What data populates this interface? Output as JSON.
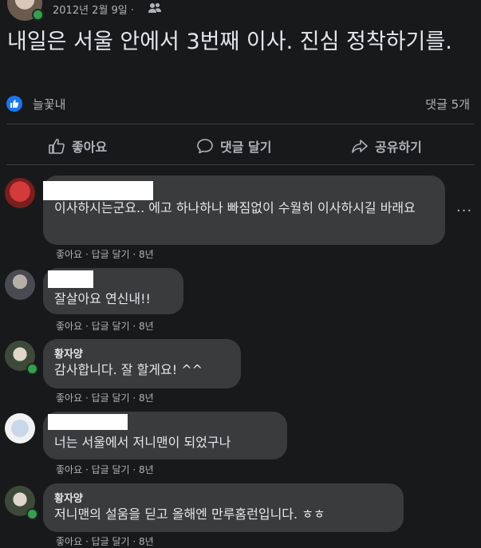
{
  "post": {
    "date": "2012년 2월 9일 ·",
    "privacy_icon": "friends-icon",
    "text": "내일은 서울 안에서 3번째 이사. 진심 정착하기를.",
    "liker": "늘꽃내",
    "comment_count": "댓글 5개"
  },
  "actions": {
    "like": "좋아요",
    "comment": "댓글 달기",
    "share": "공유하기"
  },
  "comments": [
    {
      "name": "",
      "text": "이사하시는군요.. 에고 하나하나 빠짐없이 수월히 이사하시길 바래요",
      "like": "좋아요",
      "reply": "답글 달기",
      "age": "8년"
    },
    {
      "name": "",
      "text": "잘살아요 연신내!!",
      "like": "좋아요",
      "reply": "답글 달기",
      "age": "8년"
    },
    {
      "name": "황자양",
      "text": "감사합니다. 잘 할게요! ^^",
      "like": "좋아요",
      "reply": "답글 달기",
      "age": "8년"
    },
    {
      "name": "",
      "text": "너는 서울에서 저니맨이 되었구나",
      "like": "좋아요",
      "reply": "답글 달기",
      "age": "8년"
    },
    {
      "name": "황자양",
      "text": "저니맨의 설움을 딛고 올해엔 만루홈런입니다. ㅎㅎ",
      "like": "좋아요",
      "reply": "답글 달기",
      "age": "8년"
    }
  ],
  "colors": {
    "background": "#18191a",
    "bubble": "#3a3b3c",
    "like_blue": "#1877f2",
    "online_green": "#31a24c"
  }
}
